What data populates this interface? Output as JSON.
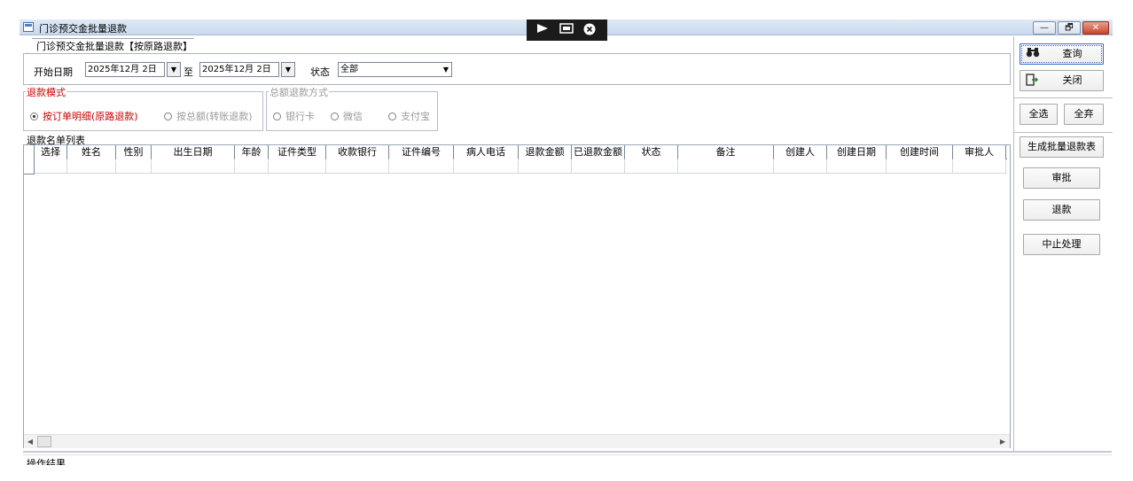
{
  "window": {
    "title": "门诊预交金批量退款",
    "controls": {
      "minimize": "—",
      "restore": "🗗",
      "close": "✕"
    }
  },
  "remote_bar": {
    "icons": [
      "pin-icon",
      "restore-session-icon",
      "close-session-icon"
    ]
  },
  "tab": {
    "label": "门诊预交金批量退款【按原路退款】"
  },
  "filter": {
    "start_label": "开始日期",
    "start_date": "2025年12月 2日",
    "to_label": "至",
    "end_date": "2025年12月 2日",
    "status_label": "状态",
    "status_value": "全部"
  },
  "refund_mode": {
    "legend": "退款模式",
    "options": [
      {
        "label": "按订单明细(原路退款)",
        "selected": true,
        "enabled": true
      },
      {
        "label": "按总额(转账退款)",
        "selected": false,
        "enabled": false
      }
    ]
  },
  "total_mode": {
    "legend": "总额退款方式",
    "options": [
      {
        "label": "银行卡",
        "selected": false,
        "enabled": false
      },
      {
        "label": "微信",
        "selected": false,
        "enabled": false
      },
      {
        "label": "支付宝",
        "selected": false,
        "enabled": false
      }
    ]
  },
  "list": {
    "title": "退款名单列表",
    "columns": [
      "选择",
      "姓名",
      "性别",
      "出生日期",
      "年龄",
      "证件类型",
      "收款银行",
      "证件编号",
      "病人电话",
      "退款金额",
      "已退款金额",
      "状态",
      "备注",
      "创建人",
      "创建日期",
      "创建时间",
      "审批人"
    ],
    "rows": []
  },
  "status_bar": {
    "label": "操作结果"
  },
  "actions": {
    "query": "查询",
    "close": "关闭",
    "select_all": "全选",
    "deselect_all": "全弃",
    "generate": "生成批量退款表",
    "approve": "审批",
    "refund": "退款",
    "abort": "中止处理"
  },
  "colors": {
    "accent_red": "#cc0000",
    "disabled_gray": "#9a9a9a",
    "title_bar": "#c9d9ee"
  }
}
